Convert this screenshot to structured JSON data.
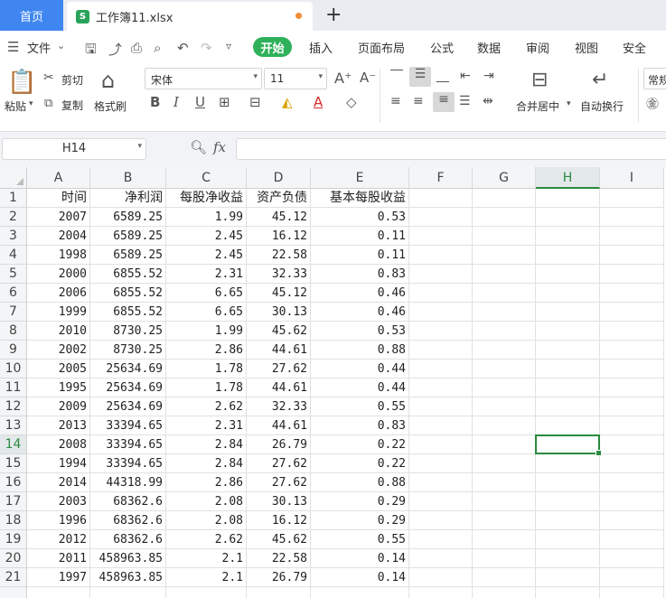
{
  "tabs": {
    "home_label": "首页",
    "file_label": "工作簿11.xlsx",
    "file_icon_letter": "S",
    "add_label": "+"
  },
  "menu": {
    "file_label": "文件",
    "items": [
      "开始",
      "插入",
      "页面布局",
      "公式",
      "数据",
      "审阅",
      "视图",
      "安全"
    ]
  },
  "ribbon": {
    "paste_label": "粘贴",
    "cut_label": "剪切",
    "copy_label": "复制",
    "format_painter_label": "格式刷",
    "font_name": "宋体",
    "font_size": "11",
    "merge_label": "合并居中",
    "wrap_label": "自动换行",
    "general_label": "常规"
  },
  "formula_bar": {
    "name_box": "H14",
    "fx_label": "fx",
    "content": ""
  },
  "grid": {
    "columns": [
      "A",
      "B",
      "C",
      "D",
      "E",
      "F",
      "G",
      "H",
      "I"
    ],
    "active_column": "H",
    "active_row": 14,
    "row_numbers": [
      "1",
      "2",
      "3",
      "4",
      "5",
      "6",
      "7",
      "8",
      "9",
      "10",
      "11",
      "12",
      "13",
      "14",
      "15",
      "16",
      "17",
      "18",
      "19",
      "20",
      "21"
    ],
    "header_row": [
      "时间",
      "净利润",
      "每股净收益",
      "资产负债",
      "基本每股收益"
    ],
    "rows": [
      [
        "2007",
        "6589.25",
        "1.99",
        "45.12",
        "0.53"
      ],
      [
        "2004",
        "6589.25",
        "2.45",
        "16.12",
        "0.11"
      ],
      [
        "1998",
        "6589.25",
        "2.45",
        "22.58",
        "0.11"
      ],
      [
        "2000",
        "6855.52",
        "2.31",
        "32.33",
        "0.83"
      ],
      [
        "2006",
        "6855.52",
        "6.65",
        "45.12",
        "0.46"
      ],
      [
        "1999",
        "6855.52",
        "6.65",
        "30.13",
        "0.46"
      ],
      [
        "2010",
        "8730.25",
        "1.99",
        "45.62",
        "0.53"
      ],
      [
        "2002",
        "8730.25",
        "2.86",
        "44.61",
        "0.88"
      ],
      [
        "2005",
        "25634.69",
        "1.78",
        "27.62",
        "0.44"
      ],
      [
        "1995",
        "25634.69",
        "1.78",
        "44.61",
        "0.44"
      ],
      [
        "2009",
        "25634.69",
        "2.62",
        "32.33",
        "0.55"
      ],
      [
        "2013",
        "33394.65",
        "2.31",
        "44.61",
        "0.83"
      ],
      [
        "2008",
        "33394.65",
        "2.84",
        "26.79",
        "0.22"
      ],
      [
        "1994",
        "33394.65",
        "2.84",
        "27.62",
        "0.22"
      ],
      [
        "2014",
        "44318.99",
        "2.86",
        "27.62",
        "0.88"
      ],
      [
        "2003",
        "68362.6",
        "2.08",
        "30.13",
        "0.29"
      ],
      [
        "1996",
        "68362.6",
        "2.08",
        "16.12",
        "0.29"
      ],
      [
        "2012",
        "68362.6",
        "2.62",
        "45.62",
        "0.55"
      ],
      [
        "2011",
        "458963.85",
        "2.1",
        "22.58",
        "0.14"
      ],
      [
        "1997",
        "458963.85",
        "2.1",
        "26.79",
        "0.14"
      ]
    ]
  }
}
